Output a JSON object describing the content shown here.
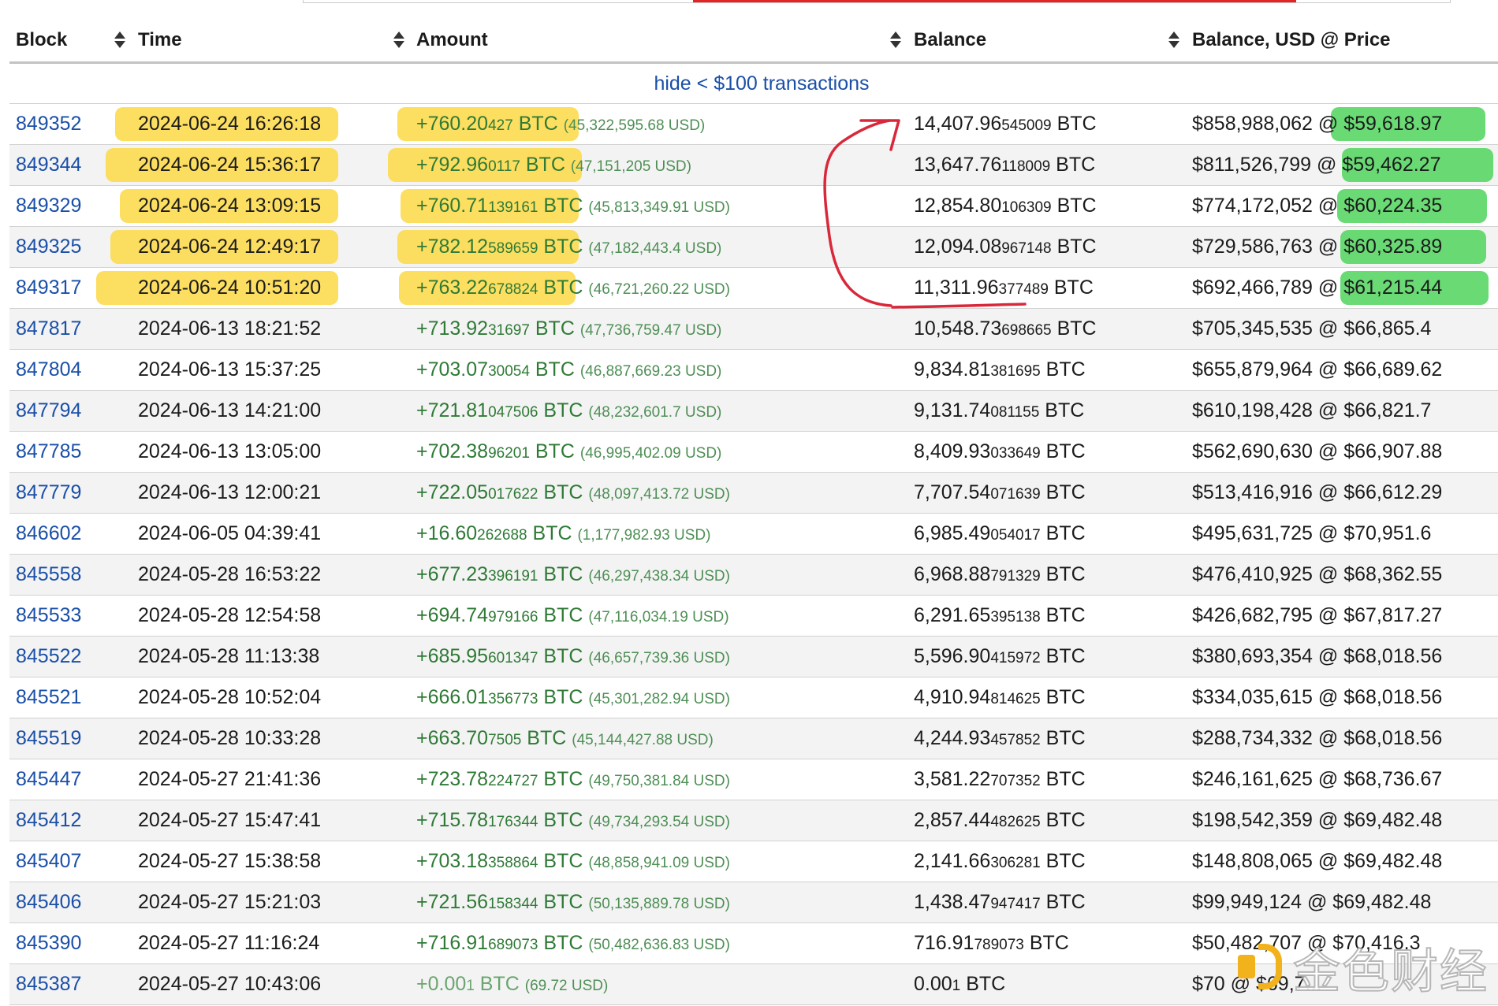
{
  "header": {
    "block": "Block",
    "time": "Time",
    "amount": "Amount",
    "balance": "Balance",
    "balance_usd": "Balance, USD @ Price"
  },
  "filter": {
    "label": "hide < $100 transactions"
  },
  "rows": [
    {
      "block": "849352",
      "time": "2024-06-24 16:26:18",
      "amt_main": "+760.20",
      "amt_small": "427",
      "amt_usd": "(45,322,595.68 USD)",
      "bal_main": "14,407.96",
      "bal_small": "545009",
      "bal_usd": "$858,988,062",
      "price": "@ $59,618.97"
    },
    {
      "block": "849344",
      "time": "2024-06-24 15:36:17",
      "amt_main": "+792.96",
      "amt_small": "0117",
      "amt_usd": "(47,151,205 USD)",
      "bal_main": "13,647.76",
      "bal_small": "118009",
      "bal_usd": "$811,526,799",
      "price": "@ $59,462.27"
    },
    {
      "block": "849329",
      "time": "2024-06-24 13:09:15",
      "amt_main": "+760.71",
      "amt_small": "139161",
      "amt_usd": "(45,813,349.91 USD)",
      "bal_main": "12,854.80",
      "bal_small": "106309",
      "bal_usd": "$774,172,052",
      "price": "@ $60,224.35"
    },
    {
      "block": "849325",
      "time": "2024-06-24 12:49:17",
      "amt_main": "+782.12",
      "amt_small": "589659",
      "amt_usd": "(47,182,443.4 USD)",
      "bal_main": "12,094.08",
      "bal_small": "967148",
      "bal_usd": "$729,586,763",
      "price": "@ $60,325.89"
    },
    {
      "block": "849317",
      "time": "2024-06-24 10:51:20",
      "amt_main": "+763.22",
      "amt_small": "678824",
      "amt_usd": "(46,721,260.22 USD)",
      "bal_main": "11,311.96",
      "bal_small": "377489",
      "bal_usd": "$692,466,789",
      "price": "@ $61,215.44"
    },
    {
      "block": "847817",
      "time": "2024-06-13 18:21:52",
      "amt_main": "+713.92",
      "amt_small": "31697",
      "amt_usd": "(47,736,759.47 USD)",
      "bal_main": "10,548.73",
      "bal_small": "698665",
      "bal_usd": "$705,345,535",
      "price": "@ $66,865.4"
    },
    {
      "block": "847804",
      "time": "2024-06-13 15:37:25",
      "amt_main": "+703.07",
      "amt_small": "30054",
      "amt_usd": "(46,887,669.23 USD)",
      "bal_main": "9,834.81",
      "bal_small": "381695",
      "bal_usd": "$655,879,964",
      "price": "@ $66,689.62"
    },
    {
      "block": "847794",
      "time": "2024-06-13 14:21:00",
      "amt_main": "+721.81",
      "amt_small": "047506",
      "amt_usd": "(48,232,601.7 USD)",
      "bal_main": "9,131.74",
      "bal_small": "081155",
      "bal_usd": "$610,198,428",
      "price": "@ $66,821.7"
    },
    {
      "block": "847785",
      "time": "2024-06-13 13:05:00",
      "amt_main": "+702.38",
      "amt_small": "96201",
      "amt_usd": "(46,995,402.09 USD)",
      "bal_main": "8,409.93",
      "bal_small": "033649",
      "bal_usd": "$562,690,630",
      "price": "@ $66,907.88"
    },
    {
      "block": "847779",
      "time": "2024-06-13 12:00:21",
      "amt_main": "+722.05",
      "amt_small": "017622",
      "amt_usd": "(48,097,413.72 USD)",
      "bal_main": "7,707.54",
      "bal_small": "071639",
      "bal_usd": "$513,416,916",
      "price": "@ $66,612.29"
    },
    {
      "block": "846602",
      "time": "2024-06-05 04:39:41",
      "amt_main": "+16.60",
      "amt_small": "262688",
      "amt_usd": "(1,177,982.93 USD)",
      "bal_main": "6,985.49",
      "bal_small": "054017",
      "bal_usd": "$495,631,725",
      "price": "@ $70,951.6"
    },
    {
      "block": "845558",
      "time": "2024-05-28 16:53:22",
      "amt_main": "+677.23",
      "amt_small": "396191",
      "amt_usd": "(46,297,438.34 USD)",
      "bal_main": "6,968.88",
      "bal_small": "791329",
      "bal_usd": "$476,410,925",
      "price": "@ $68,362.55"
    },
    {
      "block": "845533",
      "time": "2024-05-28 12:54:58",
      "amt_main": "+694.74",
      "amt_small": "979166",
      "amt_usd": "(47,116,034.19 USD)",
      "bal_main": "6,291.65",
      "bal_small": "395138",
      "bal_usd": "$426,682,795",
      "price": "@ $67,817.27"
    },
    {
      "block": "845522",
      "time": "2024-05-28 11:13:38",
      "amt_main": "+685.95",
      "amt_small": "601347",
      "amt_usd": "(46,657,739.36 USD)",
      "bal_main": "5,596.90",
      "bal_small": "415972",
      "bal_usd": "$380,693,354",
      "price": "@ $68,018.56"
    },
    {
      "block": "845521",
      "time": "2024-05-28 10:52:04",
      "amt_main": "+666.01",
      "amt_small": "356773",
      "amt_usd": "(45,301,282.94 USD)",
      "bal_main": "4,910.94",
      "bal_small": "814625",
      "bal_usd": "$334,035,615",
      "price": "@ $68,018.56"
    },
    {
      "block": "845519",
      "time": "2024-05-28 10:33:28",
      "amt_main": "+663.70",
      "amt_small": "7505",
      "amt_usd": "(45,144,427.88 USD)",
      "bal_main": "4,244.93",
      "bal_small": "457852",
      "bal_usd": "$288,734,332",
      "price": "@ $68,018.56"
    },
    {
      "block": "845447",
      "time": "2024-05-27 21:41:36",
      "amt_main": "+723.78",
      "amt_small": "224727",
      "amt_usd": "(49,750,381.84 USD)",
      "bal_main": "3,581.22",
      "bal_small": "707352",
      "bal_usd": "$246,161,625",
      "price": "@ $68,736.67"
    },
    {
      "block": "845412",
      "time": "2024-05-27 15:47:41",
      "amt_main": "+715.78",
      "amt_small": "176344",
      "amt_usd": "(49,734,293.54 USD)",
      "bal_main": "2,857.44",
      "bal_small": "482625",
      "bal_usd": "$198,542,359",
      "price": "@ $69,482.48"
    },
    {
      "block": "845407",
      "time": "2024-05-27 15:38:58",
      "amt_main": "+703.18",
      "amt_small": "358864",
      "amt_usd": "(48,858,941.09 USD)",
      "bal_main": "2,141.66",
      "bal_small": "306281",
      "bal_usd": "$148,808,065",
      "price": "@ $69,482.48"
    },
    {
      "block": "845406",
      "time": "2024-05-27 15:21:03",
      "amt_main": "+721.56",
      "amt_small": "158344",
      "amt_usd": "(50,135,889.78 USD)",
      "bal_main": "1,438.47",
      "bal_small": "947417",
      "bal_usd": "$99,949,124",
      "price": "@ $69,482.48"
    },
    {
      "block": "845390",
      "time": "2024-05-27 11:16:24",
      "amt_main": "+716.91",
      "amt_small": "689073",
      "amt_usd": "(50,482,636.83 USD)",
      "bal_main": "716.91",
      "bal_small": "789073",
      "bal_usd": "$50,482,707",
      "price": "@ $70,416.3"
    },
    {
      "block": "845387",
      "time": "2024-05-27 10:43:06",
      "amt_main": "+0.00",
      "amt_small": "1",
      "amt_usd": "(69.72 USD)",
      "bal_main": "0.00",
      "bal_small": "1",
      "bal_usd": "$70",
      "price": "@ $69,7..."
    }
  ],
  "unit": "BTC",
  "watermark": {
    "text": "金色财经"
  },
  "colors": {
    "link_blue": "#1a4fa8",
    "amount_green": "#2f7a36",
    "highlight_yellow": "#fbd844",
    "highlight_green": "#4fd35c",
    "ink_red": "#d9283a"
  }
}
